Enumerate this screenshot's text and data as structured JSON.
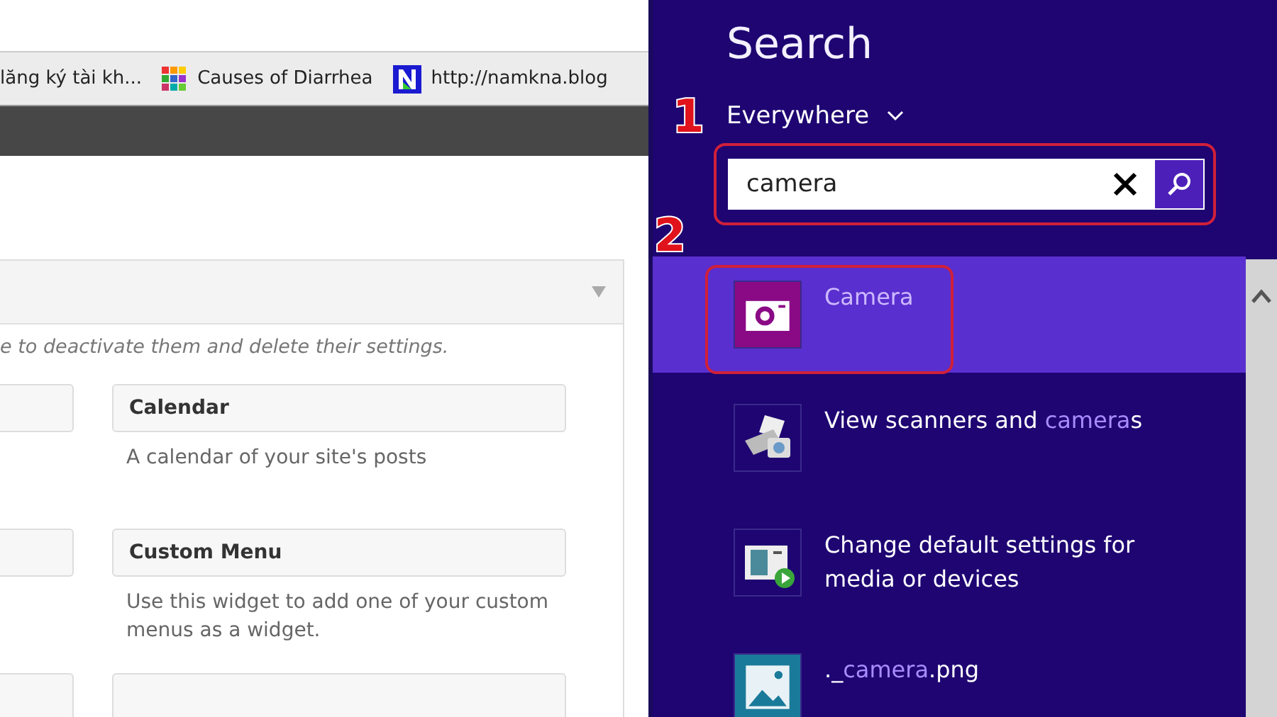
{
  "browser": {
    "bookmarks": [
      {
        "label": "lăng ký tài kh...",
        "kind": "plain"
      },
      {
        "label": "Causes of Diarrhea",
        "kind": "grid"
      },
      {
        "label": "http://namkna.blog",
        "kind": "letter"
      }
    ],
    "widgets_panel": {
      "notice": "e to deactivate them and delete their settings.",
      "widgets": [
        {
          "title": "Calendar",
          "description": "A calendar of your site's posts"
        },
        {
          "title": "Custom Menu",
          "description": "Use this widget to add one of your custom menus as a widget."
        }
      ]
    }
  },
  "search_pane": {
    "title": "Search",
    "scope": "Everywhere",
    "query": "camera",
    "results": [
      {
        "kind": "camera",
        "selected": true,
        "parts": [
          {
            "text": "Camera",
            "match": false
          }
        ]
      },
      {
        "kind": "scanner",
        "selected": false,
        "parts": [
          {
            "text": "View scanners and ",
            "match": false
          },
          {
            "text": "camera",
            "match": true
          },
          {
            "text": "s",
            "match": false
          }
        ]
      },
      {
        "kind": "media",
        "selected": false,
        "parts": [
          {
            "text": "Change default settings for media or devices",
            "match": false
          }
        ]
      },
      {
        "kind": "image",
        "selected": false,
        "parts": [
          {
            "text": "._",
            "match": false
          },
          {
            "text": "camera",
            "match": true
          },
          {
            "text": ".png",
            "match": false
          }
        ]
      }
    ]
  },
  "annotations": [
    {
      "label": "1"
    },
    {
      "label": "2"
    }
  ]
}
